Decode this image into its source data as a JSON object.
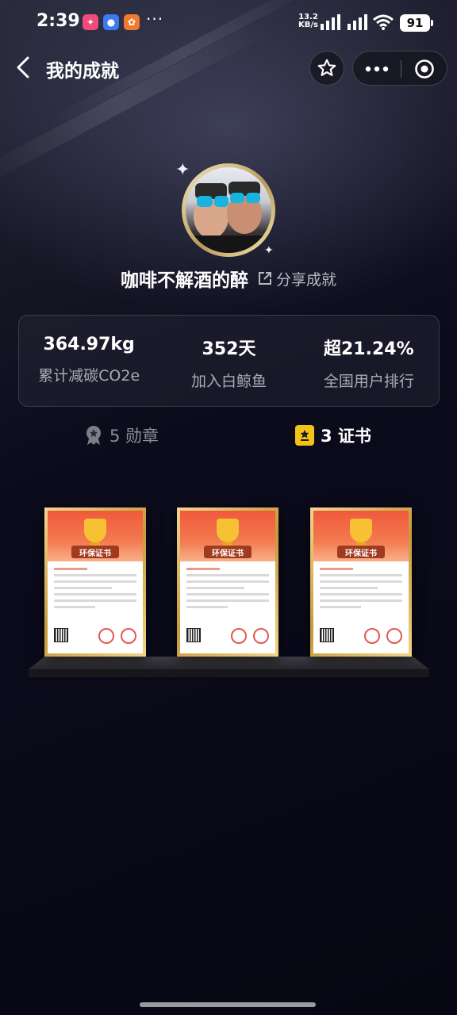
{
  "status_bar": {
    "time": "2:39",
    "more": "···",
    "net_speed_value": "13.2",
    "net_speed_unit": "KB/s",
    "battery": "91"
  },
  "nav": {
    "title": "我的成就",
    "icons": [
      "back-arrow-icon",
      "star-icon",
      "more-icon",
      "close-target-icon"
    ]
  },
  "profile": {
    "name": "咖啡不解酒的醉",
    "share_label": "分享成就"
  },
  "stats": [
    {
      "value": "364.97kg",
      "label": "累计减碳CO2e"
    },
    {
      "value": "352天",
      "label": "加入白鲸鱼"
    },
    {
      "value": "超21.24%",
      "label": "全国用户排行"
    }
  ],
  "tabs": {
    "medals_label": "5 勋章",
    "certificates_label": "3 证书"
  },
  "certificates": [
    {
      "badge": "环保证书"
    },
    {
      "badge": "环保证书"
    },
    {
      "badge": "环保证书"
    }
  ],
  "colors": {
    "background": "#080816",
    "accent_gold": "#f3c316",
    "muted_text": "#a9aab6",
    "certificate_red": "#f0593b"
  }
}
